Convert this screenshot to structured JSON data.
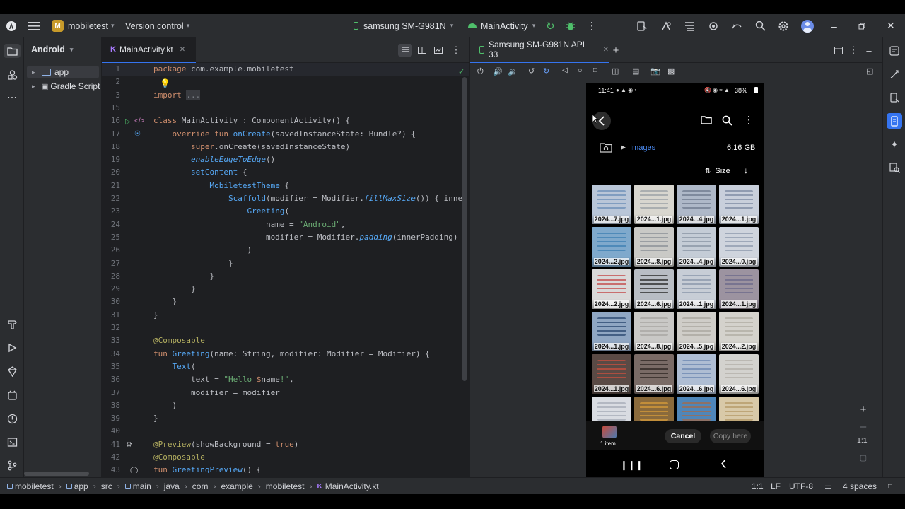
{
  "titlebar": {
    "project_badge": "M",
    "project_name": "mobiletest",
    "vcs": "Version control",
    "device": "samsung SM-G981N",
    "run_config": "MainActivity"
  },
  "project_panel": {
    "view_selector": "Android",
    "items": [
      {
        "label": "app"
      },
      {
        "label": "Gradle Script"
      }
    ]
  },
  "editor": {
    "tab_label": "MainActivity.kt",
    "lines": [
      {
        "n": "1",
        "html": "<span class='kw'>package</span> com.example.mobiletest"
      },
      {
        "n": "2",
        "html": ""
      },
      {
        "n": "3",
        "html": "<span class='kw'>import</span> <span class='cm' style='background:#393b40'>...</span>"
      },
      {
        "n": "15",
        "html": ""
      },
      {
        "n": "16",
        "html": "<span class='kw'>class</span> MainActivity : ComponentActivity() {"
      },
      {
        "n": "17",
        "html": "    <span class='kw'>override fun</span> <span class='fn'>onCreate</span>(savedInstanceState: Bundle?) {"
      },
      {
        "n": "18",
        "html": "        <span class='kw'>super</span>.onCreate(savedInstanceState)"
      },
      {
        "n": "19",
        "html": "        <span class='it'>enableEdgeToEdge</span>()"
      },
      {
        "n": "20",
        "html": "        <span class='fn'>setContent</span> {"
      },
      {
        "n": "21",
        "html": "            <span class='fn'>MobiletestTheme</span> {"
      },
      {
        "n": "22",
        "html": "                <span class='fn'>Scaffold</span>(modifier = Modifier.<span class='it'>fillMaxSize</span>()) { inner"
      },
      {
        "n": "23",
        "html": "                    <span class='fn'>Greeting</span>("
      },
      {
        "n": "24",
        "html": "                        name = <span class='str'>\"Android\"</span>,"
      },
      {
        "n": "25",
        "html": "                        modifier = Modifier.<span class='it'>padding</span>(innerPadding)"
      },
      {
        "n": "26",
        "html": "                    )"
      },
      {
        "n": "27",
        "html": "                }"
      },
      {
        "n": "28",
        "html": "            }"
      },
      {
        "n": "29",
        "html": "        }"
      },
      {
        "n": "30",
        "html": "    }"
      },
      {
        "n": "31",
        "html": "}"
      },
      {
        "n": "32",
        "html": ""
      },
      {
        "n": "33",
        "html": "<span class='ann'>@Composable</span>"
      },
      {
        "n": "34",
        "html": "<span class='kw'>fun</span> <span class='fn'>Greeting</span>(name: String, modifier: Modifier = Modifier) {"
      },
      {
        "n": "35",
        "html": "    <span class='fn'>Text</span>("
      },
      {
        "n": "36",
        "html": "        text = <span class='str'>\"Hello </span><span class='kw'>$</span>name<span class='str'>!\"</span>,"
      },
      {
        "n": "37",
        "html": "        modifier = modifier"
      },
      {
        "n": "38",
        "html": "    )"
      },
      {
        "n": "39",
        "html": "}"
      },
      {
        "n": "40",
        "html": ""
      },
      {
        "n": "41",
        "html": "<span class='ann'>@Preview</span>(showBackground = <span class='kw'>true</span>)"
      },
      {
        "n": "42",
        "html": "<span class='ann'>@Composable</span>"
      },
      {
        "n": "43",
        "html": "<span class='kw'>fun</span> <span class='fn'>GreetingPreview</span>() {"
      }
    ]
  },
  "emulator": {
    "tab_label": "Samsung SM-G981N API 33",
    "zoom_label": "1:1"
  },
  "phone": {
    "time": "11:41",
    "battery": "38%",
    "folder": "Images",
    "size_total": "6.16 GB",
    "sort_label": "Size",
    "thumbnails": [
      {
        "label": "2024...7.jpg",
        "bg": "#b9c6d8",
        "fg": "#6d8fb8"
      },
      {
        "label": "2024...1.jpg",
        "bg": "#d8d6cf",
        "fg": "#9aa0a6"
      },
      {
        "label": "2024...4.jpg",
        "bg": "#aeb8c8",
        "fg": "#6f7b8f"
      },
      {
        "label": "2024...1.jpg",
        "bg": "#c8cfdb",
        "fg": "#7d8ba3"
      },
      {
        "label": "2024...2.jpg",
        "bg": "#7fa9cc",
        "fg": "#3d7fb3"
      },
      {
        "label": "2024...8.jpg",
        "bg": "#c9c9c6",
        "fg": "#8a8f96"
      },
      {
        "label": "2024...4.jpg",
        "bg": "#c4ccd6",
        "fg": "#8894a4"
      },
      {
        "label": "2024...0.jpg",
        "bg": "#cfd4dd",
        "fg": "#8e9aad"
      },
      {
        "label": "2024...2.jpg",
        "bg": "#d9d9d9",
        "fg": "#c44a4a"
      },
      {
        "label": "2024...6.jpg",
        "bg": "#b8bdc4",
        "fg": "#2b2b2b"
      },
      {
        "label": "2024...1.jpg",
        "bg": "#c7cdd6",
        "fg": "#8a96aa"
      },
      {
        "label": "2024...1.jpg",
        "bg": "#9c93a0",
        "fg": "#6c6a8a"
      },
      {
        "label": "2024...1.jpg",
        "bg": "#8fa6c2",
        "fg": "#2a4770"
      },
      {
        "label": "2024...8.jpg",
        "bg": "#c9c8c6",
        "fg": "#a7a6a2"
      },
      {
        "label": "2024...5.jpg",
        "bg": "#cfcdc8",
        "fg": "#aaa79f"
      },
      {
        "label": "2024...2.jpg",
        "bg": "#d4d2cc",
        "fg": "#b0aca3"
      },
      {
        "label": "2024...1.jpg",
        "bg": "#5a4a45",
        "fg": "#c9503f"
      },
      {
        "label": "2024...6.jpg",
        "bg": "#7a6b66",
        "fg": "#2e2622"
      },
      {
        "label": "2024...6.jpg",
        "bg": "#aebdd3",
        "fg": "#6b86b0"
      },
      {
        "label": "2024...6.jpg",
        "bg": "#d3d2ce",
        "fg": "#b3b0a8"
      },
      {
        "label": "",
        "bg": "#d9dce2",
        "fg": "#a6acb8"
      },
      {
        "label": "",
        "bg": "#8a6a3c",
        "fg": "#d59a3a"
      },
      {
        "label": "",
        "bg": "#4f86b9",
        "fg": "#a36a4b"
      },
      {
        "label": "",
        "bg": "#d8c9a8",
        "fg": "#b69a68"
      }
    ],
    "selection_count": "1 item",
    "cancel": "Cancel",
    "copy_here": "Copy here"
  },
  "breadcrumb": [
    "mobiletest",
    "app",
    "src",
    "main",
    "java",
    "com",
    "example",
    "mobiletest",
    "MainActivity.kt"
  ],
  "status": {
    "position": "1:1",
    "line_sep": "LF",
    "encoding": "UTF-8",
    "indent": "4 spaces"
  },
  "colors": {
    "accent": "#3574f0",
    "ide_bg": "#2b2d30",
    "editor_bg": "#1e1f22",
    "phone_link": "#4c8df6"
  }
}
